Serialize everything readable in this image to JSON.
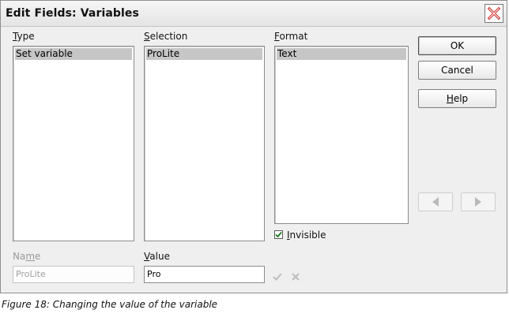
{
  "window": {
    "title": "Edit Fields: Variables"
  },
  "type_list": {
    "label_mnemonic": "T",
    "label_rest": "ype",
    "items": [
      {
        "label": "Set variable",
        "selected": true
      }
    ]
  },
  "selection_list": {
    "label_mnemonic": "S",
    "label_rest": "election",
    "items": [
      {
        "label": "ProLite",
        "selected": true
      }
    ]
  },
  "format_list": {
    "label_mnemonic": "F",
    "label_rest": "ormat",
    "items": [
      {
        "label": "Text",
        "selected": true
      }
    ]
  },
  "invisible": {
    "label_mnemonic": "I",
    "label_rest": "nvisible",
    "checked": true
  },
  "name_field": {
    "label_start": "Na",
    "label_mnemonic": "m",
    "label_rest": "e",
    "value": "ProLite",
    "disabled": true
  },
  "value_field": {
    "label_mnemonic": "V",
    "label_rest": "alue",
    "value": "Pro"
  },
  "buttons": {
    "ok": "OK",
    "cancel": "Cancel",
    "help_mnemonic": "H",
    "help_rest": "elp"
  },
  "icons": {
    "close": "close-icon",
    "apply": "checkmark-icon",
    "delete": "delete-icon",
    "previous": "arrow-left-icon",
    "next": "arrow-right-icon"
  },
  "caption": "Figure 18: Changing the value of the variable",
  "colors": {
    "selection": "#c6c6c6",
    "close_x": "#d0312d",
    "dialog_bg": "#efefef"
  }
}
